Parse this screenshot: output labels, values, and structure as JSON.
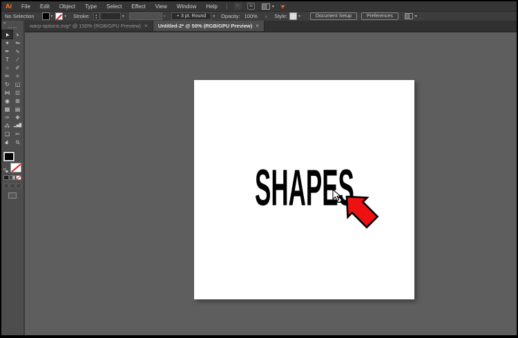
{
  "menubar": {
    "logo": "Ai",
    "items": [
      "File",
      "Edit",
      "Object",
      "Type",
      "Select",
      "Effect",
      "View",
      "Window",
      "Help"
    ],
    "bridge_glyph": "Br",
    "stock_glyph": "St"
  },
  "controlbar": {
    "selection_status": "No Selection",
    "stroke_label": "Stroke:",
    "brush_bullet": "•",
    "brush_value": "3 pt. Round",
    "opacity_label": "Opacity:",
    "opacity_value": "100%",
    "opacity_more": "›",
    "style_label": "Style:",
    "document_setup_label": "Document Setup",
    "preferences_label": "Preferences"
  },
  "tabs": [
    {
      "label": "warp-options.svg* @ 150% (RGB/GPU Preview)",
      "close": "×",
      "active": false
    },
    {
      "label": "Untitled-2* @ 50% (RGB/GPU Preview)",
      "close": "×",
      "active": true
    }
  ],
  "toolbar": {
    "collapse_glyph": "«",
    "tools": [
      {
        "name": "selection-tool",
        "glyph": "➤",
        "rot": -115,
        "selected": true
      },
      {
        "name": "direct-selection-tool",
        "glyph": "➢",
        "rot": -115
      },
      {
        "name": "magic-wand-tool",
        "glyph": "✶"
      },
      {
        "name": "lasso-tool",
        "glyph": "↬"
      },
      {
        "name": "pen-tool",
        "glyph": "✒"
      },
      {
        "name": "curvature-tool",
        "glyph": "∿"
      },
      {
        "name": "type-tool",
        "glyph": "T"
      },
      {
        "name": "line-segment-tool",
        "glyph": "∕"
      },
      {
        "name": "ellipse-tool",
        "glyph": "○"
      },
      {
        "name": "paintbrush-tool",
        "glyph": "✐"
      },
      {
        "name": "pencil-tool",
        "glyph": "✏"
      },
      {
        "name": "shaper-tool",
        "glyph": "✧"
      },
      {
        "name": "rotate-tool",
        "glyph": "↻"
      },
      {
        "name": "scale-tool",
        "glyph": "◱"
      },
      {
        "name": "width-tool",
        "glyph": "⋈"
      },
      {
        "name": "free-transform-tool",
        "glyph": "⊡"
      },
      {
        "name": "shape-builder-tool",
        "glyph": "◉"
      },
      {
        "name": "perspective-grid-tool",
        "glyph": "⊞"
      },
      {
        "name": "mesh-tool",
        "glyph": "▦"
      },
      {
        "name": "gradient-tool",
        "glyph": "▤"
      },
      {
        "name": "eyedropper-tool",
        "glyph": "✑"
      },
      {
        "name": "blend-tool",
        "glyph": "❖"
      },
      {
        "name": "symbol-sprayer-tool",
        "glyph": "⁂"
      },
      {
        "name": "column-graph-tool",
        "glyph": "▂▅█"
      },
      {
        "name": "artboard-tool",
        "glyph": "❏"
      },
      {
        "name": "slice-tool",
        "glyph": "✂"
      },
      {
        "name": "hand-tool",
        "glyph": "☛",
        "rot": -45
      },
      {
        "name": "zoom-tool",
        "glyph": "⚲",
        "rot": -45
      }
    ]
  },
  "canvas": {
    "artboard_text": "SHAPES"
  },
  "colors": {
    "arrow_red": "#ee1111",
    "logo_orange": "#ff7c1a",
    "none_slash_red": "#e01616"
  }
}
